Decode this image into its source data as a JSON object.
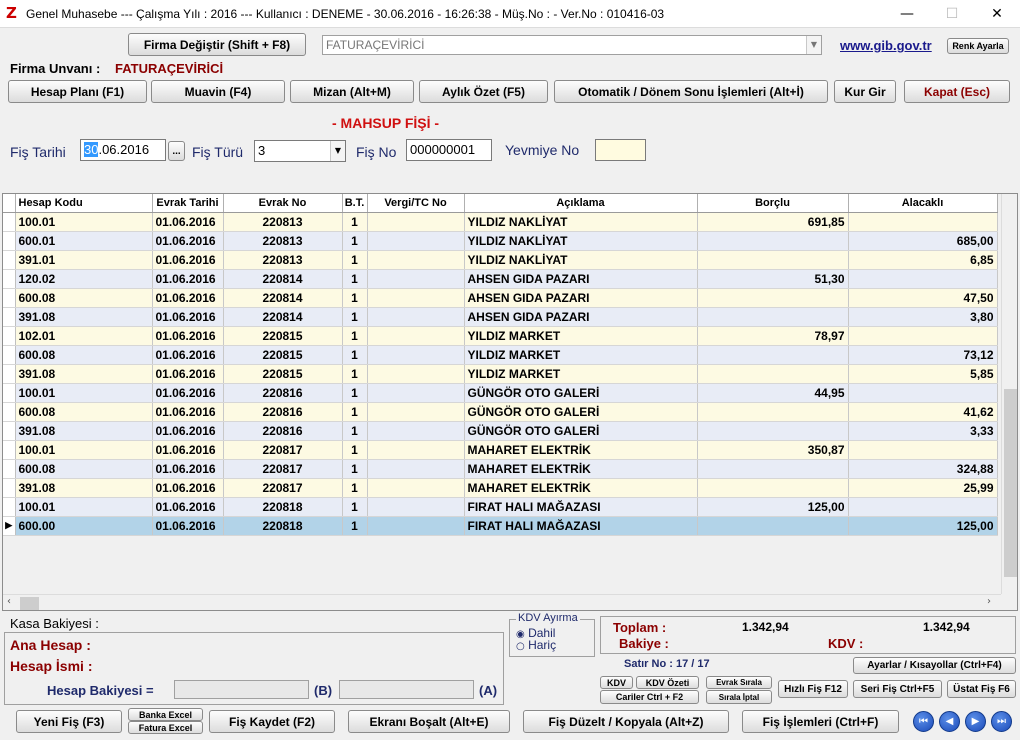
{
  "window": {
    "title": "Genel Muhasebe  ---  Çalışma Yılı : 2016  ---  Kullanıcı : DENEME - 30.06.2016 - 16:26:38 - Müş.No : - Ver.No : 010416-03",
    "icon": "Z",
    "minimize": "—",
    "maximize": "☐",
    "close": "✕"
  },
  "header": {
    "firma_degistir": "Firma Değiştir (Shift + F8)",
    "firma_combo_value": "FATURAÇEVİRİCİ",
    "gib_link": "www.gib.gov.tr",
    "renk_ayarla": "Renk Ayarla",
    "firma_unvani_label": "Firma Unvanı :",
    "firma_unvani_value": "FATURAÇEVİRİCİ"
  },
  "toolbar": {
    "hesap_plani": "Hesap Planı (F1)",
    "muavin": "Muavin (F4)",
    "mizan": "Mizan (Alt+M)",
    "aylik_ozet": "Aylık Özet (F5)",
    "otomatik": "Otomatik / Dönem Sonu İşlemleri (Alt+İ)",
    "kur_gir": "Kur Gir",
    "kapat": "Kapat (Esc)"
  },
  "form": {
    "title": "- MAHSUP FİŞİ -",
    "fis_tarihi_label": "Fiş Tarihi",
    "fis_tarihi_sel": "30",
    "fis_tarihi_rest": ".06.2016",
    "dots": "...",
    "fis_turu_label": "Fiş Türü",
    "fis_turu_value": "3",
    "fis_no_label": "Fiş No",
    "fis_no_value": "000000001",
    "yevmiye_label": "Yevmiye No",
    "yevmiye_value": ""
  },
  "grid": {
    "columns": [
      "Hesap Kodu",
      "Evrak Tarihi",
      "Evrak No",
      "B.T.",
      "Vergi/TC No",
      "Açıklama",
      "Borçlu",
      "Alacaklı"
    ],
    "rows": [
      [
        "100.01",
        "01.06.2016",
        "220813",
        "1",
        "",
        "YILDIZ NAKLİYAT",
        "691,85",
        ""
      ],
      [
        "600.01",
        "01.06.2016",
        "220813",
        "1",
        "",
        "YILDIZ NAKLİYAT",
        "",
        "685,00"
      ],
      [
        "391.01",
        "01.06.2016",
        "220813",
        "1",
        "",
        "YILDIZ NAKLİYAT",
        "",
        "6,85"
      ],
      [
        "120.02",
        "01.06.2016",
        "220814",
        "1",
        "",
        "AHSEN GIDA PAZARI",
        "51,30",
        ""
      ],
      [
        "600.08",
        "01.06.2016",
        "220814",
        "1",
        "",
        "AHSEN GIDA PAZARI",
        "",
        "47,50"
      ],
      [
        "391.08",
        "01.06.2016",
        "220814",
        "1",
        "",
        "AHSEN GIDA PAZARI",
        "",
        "3,80"
      ],
      [
        "102.01",
        "01.06.2016",
        "220815",
        "1",
        "",
        "YILDIZ MARKET",
        "78,97",
        ""
      ],
      [
        "600.08",
        "01.06.2016",
        "220815",
        "1",
        "",
        "YILDIZ MARKET",
        "",
        "73,12"
      ],
      [
        "391.08",
        "01.06.2016",
        "220815",
        "1",
        "",
        "YILDIZ MARKET",
        "",
        "5,85"
      ],
      [
        "100.01",
        "01.06.2016",
        "220816",
        "1",
        "",
        "GÜNGÖR OTO GALERİ",
        "44,95",
        ""
      ],
      [
        "600.08",
        "01.06.2016",
        "220816",
        "1",
        "",
        "GÜNGÖR OTO GALERİ",
        "",
        "41,62"
      ],
      [
        "391.08",
        "01.06.2016",
        "220816",
        "1",
        "",
        "GÜNGÖR OTO GALERİ",
        "",
        "3,33"
      ],
      [
        "100.01",
        "01.06.2016",
        "220817",
        "1",
        "",
        "MAHARET ELEKTRİK",
        "350,87",
        ""
      ],
      [
        "600.08",
        "01.06.2016",
        "220817",
        "1",
        "",
        "MAHARET ELEKTRİK",
        "",
        "324,88"
      ],
      [
        "391.08",
        "01.06.2016",
        "220817",
        "1",
        "",
        "MAHARET ELEKTRİK",
        "",
        "25,99"
      ],
      [
        "100.01",
        "01.06.2016",
        "220818",
        "1",
        "",
        "FIRAT HALI MAĞAZASI",
        "125,00",
        ""
      ],
      [
        "600.00",
        "01.06.2016",
        "220818",
        "1",
        "",
        "FIRAT HALI MAĞAZASI",
        "",
        "125,00"
      ]
    ],
    "active_row": 16,
    "row_marker": "▶"
  },
  "bottom": {
    "kasa_bakiyesi": "Kasa Bakiyesi :",
    "ana_hesap": "Ana Hesap :",
    "hesap_ismi": "Hesap İsmi :",
    "hesap_bakiyesi": "Hesap Bakiyesi =",
    "b_label": "(B)",
    "a_label": "(A)",
    "kdv_ayirma": "KDV Ayırma",
    "dahil": "Dahil",
    "haric": "Hariç",
    "toplam_label": "Toplam :",
    "toplam_borc": "1.342,94",
    "toplam_alacak": "1.342,94",
    "bakiye_label": "Bakiye :",
    "kdv_label": "KDV :",
    "satir_no": "Satır No : 17 / 17",
    "ayarlar": "Ayarlar / Kısayollar (Ctrl+F4)",
    "kdv": "KDV",
    "kdv_ozeti": "KDV Özeti",
    "evrak_sirala": "Evrak Sırala",
    "cariler": "Cariler Ctrl + F2",
    "sirala_iptal": "Sırala İptal",
    "hizli_fis": "Hızlı Fiş F12",
    "seri_fis": "Seri Fiş Ctrl+F5",
    "ustat_fis": "Üstat Fiş F6"
  },
  "footer": {
    "yeni_fis": "Yeni Fiş (F3)",
    "banka_excel": "Banka Excel",
    "fatura_excel": "Fatura Excel",
    "fis_kaydet": "Fiş Kaydet (F2)",
    "ekrani_bosalt": "Ekranı Boşalt (Alt+E)",
    "fis_duzelt": "Fiş Düzelt / Kopyala (Alt+Z)",
    "fis_islemleri": "Fiş İşlemleri (Ctrl+F)",
    "nav_first": "⏮",
    "nav_prev": "◀",
    "nav_next": "▶",
    "nav_last": "⏭"
  }
}
